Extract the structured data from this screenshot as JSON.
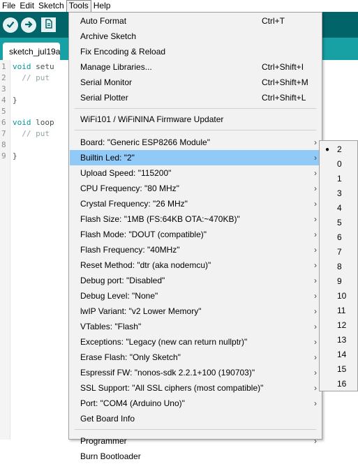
{
  "menubar": {
    "file": "File",
    "edit": "Edit",
    "sketch": "Sketch",
    "tools": "Tools",
    "help": "Help"
  },
  "toolbar": {
    "verify_icon": "check-icon",
    "upload_icon": "arrow-right-icon",
    "new_icon": "document-icon",
    "background": "#006468"
  },
  "tab": {
    "label": "sketch_jul19a"
  },
  "editor": {
    "lines": [
      {
        "n": "1",
        "kw": "void",
        "rest": " setu",
        "cm": ""
      },
      {
        "n": "2",
        "kw": "",
        "rest": "  ",
        "cm": "// put"
      },
      {
        "n": "3",
        "kw": "",
        "rest": "",
        "cm": ""
      },
      {
        "n": "4",
        "kw": "",
        "rest": "}",
        "cm": ""
      },
      {
        "n": "5",
        "kw": "",
        "rest": "",
        "cm": ""
      },
      {
        "n": "6",
        "kw": "void",
        "rest": " loop",
        "cm": ""
      },
      {
        "n": "7",
        "kw": "",
        "rest": "  ",
        "cm": "// put"
      },
      {
        "n": "8",
        "kw": "",
        "rest": "",
        "cm": ""
      },
      {
        "n": "9",
        "kw": "",
        "rest": "}",
        "cm": ""
      }
    ]
  },
  "tools_menu": {
    "group1": [
      {
        "label": "Auto Format",
        "shortcut": "Ctrl+T"
      },
      {
        "label": "Archive Sketch",
        "shortcut": ""
      },
      {
        "label": "Fix Encoding & Reload",
        "shortcut": ""
      },
      {
        "label": "Manage Libraries...",
        "shortcut": "Ctrl+Shift+I"
      },
      {
        "label": "Serial Monitor",
        "shortcut": "Ctrl+Shift+M"
      },
      {
        "label": "Serial Plotter",
        "shortcut": "Ctrl+Shift+L"
      }
    ],
    "group2": [
      {
        "label": "WiFi101 / WiFiNINA Firmware Updater"
      }
    ],
    "group3": [
      {
        "label": "Board: \"Generic ESP8266 Module\"",
        "submenu": true
      },
      {
        "label": "Builtin Led: \"2\"",
        "submenu": true,
        "highlighted": true
      },
      {
        "label": "Upload Speed: \"115200\"",
        "submenu": true
      },
      {
        "label": "CPU Frequency: \"80 MHz\"",
        "submenu": true
      },
      {
        "label": "Crystal Frequency: \"26 MHz\"",
        "submenu": true
      },
      {
        "label": "Flash Size: \"1MB (FS:64KB OTA:~470KB)\"",
        "submenu": true
      },
      {
        "label": "Flash Mode: \"DOUT (compatible)\"",
        "submenu": true
      },
      {
        "label": "Flash Frequency: \"40MHz\"",
        "submenu": true
      },
      {
        "label": "Reset Method: \"dtr (aka nodemcu)\"",
        "submenu": true
      },
      {
        "label": "Debug port: \"Disabled\"",
        "submenu": true
      },
      {
        "label": "Debug Level: \"None\"",
        "submenu": true
      },
      {
        "label": "lwIP Variant: \"v2 Lower Memory\"",
        "submenu": true
      },
      {
        "label": "VTables: \"Flash\"",
        "submenu": true
      },
      {
        "label": "Exceptions: \"Legacy (new can return nullptr)\"",
        "submenu": true
      },
      {
        "label": "Erase Flash: \"Only Sketch\"",
        "submenu": true
      },
      {
        "label": "Espressif FW: \"nonos-sdk 2.2.1+100 (190703)\"",
        "submenu": true
      },
      {
        "label": "SSL Support: \"All SSL ciphers (most compatible)\"",
        "submenu": true
      },
      {
        "label": "Port: \"COM4 (Arduino Uno)\"",
        "submenu": true
      },
      {
        "label": "Get Board Info",
        "submenu": false
      }
    ],
    "group4": [
      {
        "label": "Programmer",
        "submenu": true
      },
      {
        "label": "Burn Bootloader",
        "submenu": false
      }
    ],
    "submenu_arrow": "›",
    "highlight_color": "#91c9f7"
  },
  "builtin_led_submenu": {
    "selected_marker": "●",
    "options": [
      "2",
      "0",
      "1",
      "3",
      "4",
      "5",
      "6",
      "7",
      "8",
      "9",
      "10",
      "11",
      "12",
      "13",
      "14",
      "15",
      "16"
    ],
    "selected": "2"
  }
}
